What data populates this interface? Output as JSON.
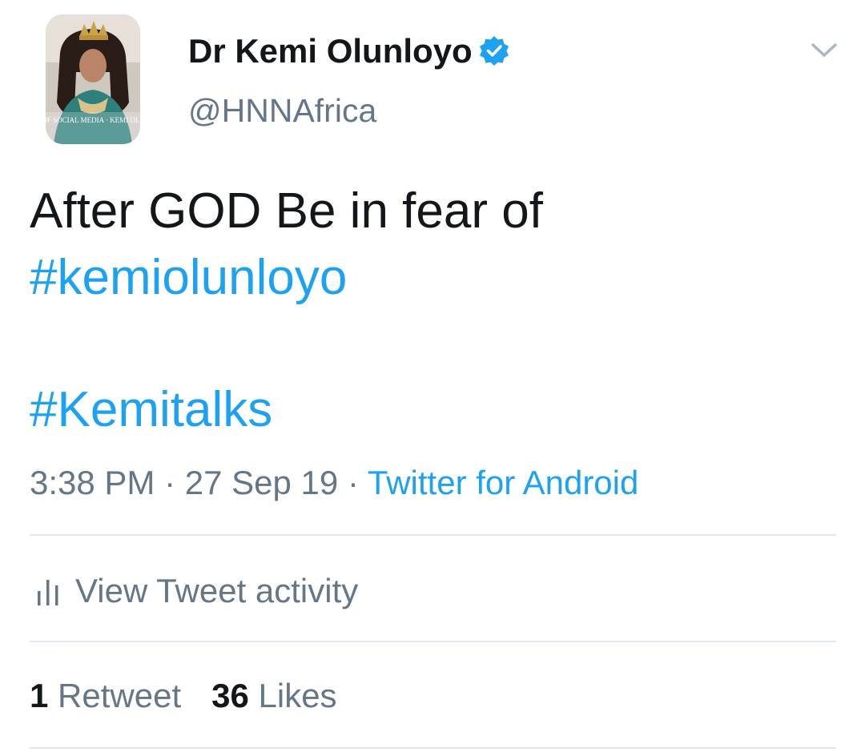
{
  "tweet": {
    "author": {
      "display_name": "Dr Kemi Olunloyo",
      "handle": "@HNNAfrica",
      "verified": true,
      "avatar_icon": "profile-photo-avatar",
      "avatar_text": "QUEEN OF SOCIAL MEDIA · KEMI OLUNLOYO"
    },
    "menu_icon": "chevron-down-icon",
    "text_line1": "After GOD Be in fear of",
    "hashtag1": "#kemiolunloyo",
    "hashtag2": "#Kemitalks",
    "time": "3:38 PM",
    "separator": "·",
    "date": "27 Sep 19",
    "source": "Twitter for Android",
    "activity_label": "View Tweet activity",
    "activity_icon": "bar-chart-icon",
    "retweets_count": "1",
    "retweets_label": "Retweet",
    "likes_count": "36",
    "likes_label": "Likes"
  },
  "colors": {
    "link": "#1da1f2",
    "text_primary": "#14171a",
    "text_secondary": "#657786",
    "divider": "#e1e8ed",
    "verified_badge": "#1da1f2"
  }
}
